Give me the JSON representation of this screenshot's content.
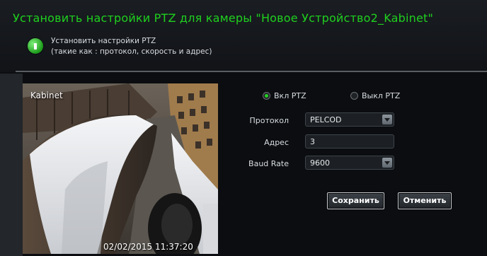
{
  "header": {
    "title": "Установить настройки  PTZ  для камеры  \"Новое Устройство2_Kabinet\"",
    "info_line1": "Установить настройки  PTZ",
    "info_line2": "(такие как : протокол, скорость и адрес)"
  },
  "camera": {
    "label": "Kabinet",
    "timestamp": "02/02/2015 11:37:20"
  },
  "ptz": {
    "on_label": "Вкл PTZ",
    "off_label": "Выкл PTZ",
    "selected": "on"
  },
  "form": {
    "protocol_label": "Протокол",
    "protocol_value": "PELCOD",
    "address_label": "Адрес",
    "address_value": "3",
    "baud_label": "Baud Rate",
    "baud_value": "9600"
  },
  "buttons": {
    "save": "Сохранить",
    "cancel": "Отменить"
  },
  "colors": {
    "title": "#1fd11f",
    "background": "#0b0d10",
    "radio_selected": "#27d127"
  }
}
